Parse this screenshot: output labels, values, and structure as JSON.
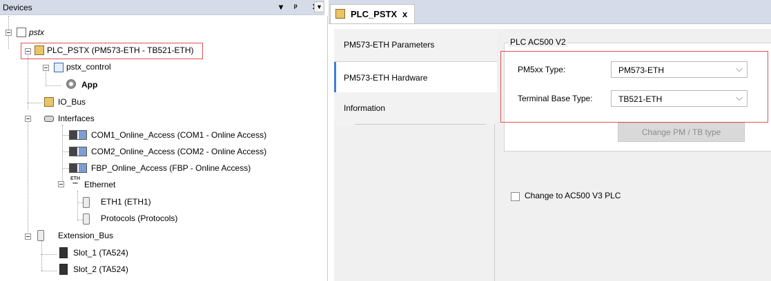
{
  "devices": {
    "title": "Devices",
    "pin": "↓",
    "dock": "†",
    "close": "✕",
    "tree": {
      "root": "pstx",
      "plc": "PLC_PSTX (PM573-ETH - TB521-ETH)",
      "control": "pstx_control",
      "app": "App",
      "io_bus": "IO_Bus",
      "interfaces": "Interfaces",
      "com1": "COM1_Online_Access (COM1 - Online Access)",
      "com2": "COM2_Online_Access (COM2 - Online Access)",
      "fbp": "FBP_Online_Access (FBP - Online Access)",
      "ethernet": "Ethernet",
      "eth1": "ETH1 (ETH1)",
      "protocols": "Protocols (Protocols)",
      "extension_bus": "Extension_Bus",
      "slot1": "Slot_1 (TA524)",
      "slot2": "Slot_2 (TA524)"
    }
  },
  "editor": {
    "tab_label": "PLC_PSTX",
    "tab_close": "x",
    "side_tabs": [
      "PM573-ETH Parameters",
      "PM573-ETH Hardware",
      "Information"
    ],
    "group_title": "PLC AC500 V2",
    "pm_type_label": "PM5xx Type:",
    "pm_type_value": "PM573-ETH",
    "tb_type_label": "Terminal Base Type:",
    "tb_type_value": "TB521-ETH",
    "change_button": "Change PM / TB type",
    "v3_checkbox_label": "Change to AC500 V3 PLC",
    "v3_checked": false
  },
  "colors": {
    "highlight_border": "#e05050",
    "panel_header": "#d6dbe9",
    "active_tab_accent": "#3c7fd6"
  }
}
